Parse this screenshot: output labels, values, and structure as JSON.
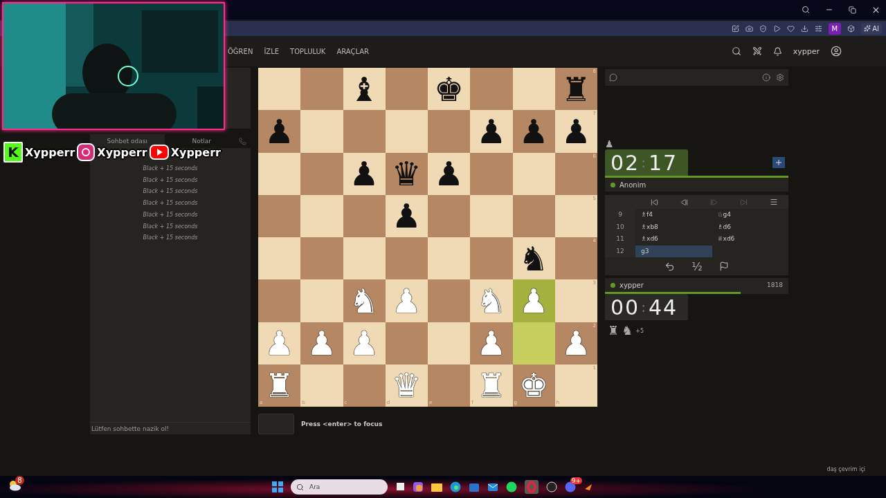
{
  "browser": {
    "profile_badge": "M",
    "ai_button": "AI"
  },
  "stream_overlay": {
    "handles": [
      {
        "kind": "kick",
        "badge": "K",
        "name": "Xypperr"
      },
      {
        "kind": "instagram",
        "name": "Xypperr"
      },
      {
        "kind": "youtube",
        "name": "Xypperr"
      }
    ]
  },
  "site_header": {
    "nav": [
      "ÖĞREN",
      "İZLE",
      "TOPLULUK",
      "ARAÇLAR"
    ],
    "username": "xypper"
  },
  "chat": {
    "tabs": [
      {
        "label": "Sohbet odası",
        "selected": true
      },
      {
        "label": "Notlar",
        "selected": false
      }
    ],
    "messages": [
      "Black + 15 seconds",
      "Black + 15 seconds",
      "Black + 15 seconds",
      "Black + 15 seconds",
      "Black + 15 seconds",
      "Black + 15 seconds",
      "Black + 15 seconds"
    ],
    "placeholder": "Lütfen sohbette nazik ol!"
  },
  "board": {
    "files": [
      "a",
      "b",
      "c",
      "d",
      "e",
      "f",
      "g",
      "h"
    ],
    "rows": [
      {
        "rank": "8",
        "squares": [
          {
            "highlighted": false
          },
          {
            "highlighted": false
          },
          {
            "highlighted": false,
            "piece": {
              "glyph": "♝",
              "white": false
            }
          },
          {
            "highlighted": false
          },
          {
            "highlighted": false,
            "piece": {
              "glyph": "♚",
              "white": false
            }
          },
          {
            "highlighted": false
          },
          {
            "highlighted": false
          },
          {
            "highlighted": false,
            "piece": {
              "glyph": "♜",
              "white": false
            }
          }
        ]
      },
      {
        "rank": "7",
        "squares": [
          {
            "highlighted": false,
            "piece": {
              "glyph": "♟",
              "white": false
            }
          },
          {
            "highlighted": false
          },
          {
            "highlighted": false
          },
          {
            "highlighted": false
          },
          {
            "highlighted": false
          },
          {
            "highlighted": false,
            "piece": {
              "glyph": "♟",
              "white": false
            }
          },
          {
            "highlighted": false,
            "piece": {
              "glyph": "♟",
              "white": false
            }
          },
          {
            "highlighted": false,
            "piece": {
              "glyph": "♟",
              "white": false
            }
          }
        ]
      },
      {
        "rank": "6",
        "squares": [
          {
            "highlighted": false
          },
          {
            "highlighted": false
          },
          {
            "highlighted": false,
            "piece": {
              "glyph": "♟",
              "white": false
            }
          },
          {
            "highlighted": false,
            "piece": {
              "glyph": "♛",
              "white": false
            }
          },
          {
            "highlighted": false,
            "piece": {
              "glyph": "♟",
              "white": false
            }
          },
          {
            "highlighted": false
          },
          {
            "highlighted": false
          },
          {
            "highlighted": false
          }
        ]
      },
      {
        "rank": "5",
        "squares": [
          {
            "highlighted": false
          },
          {
            "highlighted": false
          },
          {
            "highlighted": false
          },
          {
            "highlighted": false,
            "piece": {
              "glyph": "♟",
              "white": false
            }
          },
          {
            "highlighted": false
          },
          {
            "highlighted": false
          },
          {
            "highlighted": false
          },
          {
            "highlighted": false
          }
        ]
      },
      {
        "rank": "4",
        "squares": [
          {
            "highlighted": false
          },
          {
            "highlighted": false
          },
          {
            "highlighted": false
          },
          {
            "highlighted": false
          },
          {
            "highlighted": false
          },
          {
            "highlighted": false
          },
          {
            "highlighted": false,
            "piece": {
              "glyph": "♞",
              "white": false
            }
          },
          {
            "highlighted": false
          }
        ]
      },
      {
        "rank": "3",
        "squares": [
          {
            "highlighted": false
          },
          {
            "highlighted": false
          },
          {
            "highlighted": false,
            "piece": {
              "glyph": "♞",
              "white": true
            }
          },
          {
            "highlighted": false,
            "piece": {
              "glyph": "♟",
              "white": true
            }
          },
          {
            "highlighted": false
          },
          {
            "highlighted": false,
            "piece": {
              "glyph": "♞",
              "white": true
            }
          },
          {
            "highlighted": true,
            "piece": {
              "glyph": "♟",
              "white": true
            }
          },
          {
            "highlighted": false
          }
        ]
      },
      {
        "rank": "2",
        "squares": [
          {
            "highlighted": false,
            "piece": {
              "glyph": "♟",
              "white": true
            }
          },
          {
            "highlighted": false,
            "piece": {
              "glyph": "♟",
              "white": true
            }
          },
          {
            "highlighted": false,
            "piece": {
              "glyph": "♟",
              "white": true
            }
          },
          {
            "highlighted": false
          },
          {
            "highlighted": false
          },
          {
            "highlighted": false,
            "piece": {
              "glyph": "♟",
              "white": true
            }
          },
          {
            "highlighted": true
          },
          {
            "highlighted": false,
            "piece": {
              "glyph": "♟",
              "white": true
            }
          }
        ]
      },
      {
        "rank": "1",
        "squares": [
          {
            "highlighted": false,
            "piece": {
              "glyph": "♜",
              "white": true
            }
          },
          {
            "highlighted": false
          },
          {
            "highlighted": false
          },
          {
            "highlighted": false,
            "piece": {
              "glyph": "♛",
              "white": true
            }
          },
          {
            "highlighted": false
          },
          {
            "highlighted": false,
            "piece": {
              "glyph": "♜",
              "white": true
            }
          },
          {
            "highlighted": false,
            "piece": {
              "glyph": "♚",
              "white": true
            }
          },
          {
            "highlighted": false
          }
        ]
      }
    ]
  },
  "move_input": {
    "hint": "Press <enter> to focus"
  },
  "opponent": {
    "name": "Anonim",
    "online": true,
    "captured": [
      {
        "glyph": "♟"
      }
    ],
    "clock": {
      "minutes": "02",
      "separator": ":",
      "seconds": "17",
      "running": true
    },
    "level": 1
  },
  "moves": [
    {
      "number": "9",
      "moves": [
        {
          "san": "♗f4",
          "selected": false
        },
        {
          "san": "♘g4",
          "selected": false
        }
      ]
    },
    {
      "number": "10",
      "moves": [
        {
          "san": "♗xb8",
          "selected": false
        },
        {
          "san": "♗d6",
          "selected": false
        }
      ]
    },
    {
      "number": "11",
      "moves": [
        {
          "san": "♗xd6",
          "selected": false
        },
        {
          "san": "♕xd6",
          "selected": false
        }
      ]
    },
    {
      "number": "12",
      "moves": [
        {
          "san": "g3",
          "selected": true
        }
      ]
    }
  ],
  "actions": {
    "draw_offer": "½"
  },
  "player": {
    "name": "xypper",
    "online": true,
    "rating": "1818",
    "level": 0.74,
    "clock": {
      "minutes": "00",
      "separator": ":",
      "seconds": "44",
      "running": false
    },
    "material": [
      {
        "glyph": "♜"
      },
      {
        "glyph": "♞"
      }
    ],
    "advantage": "+5"
  },
  "taskbar": {
    "weather_badge": "8",
    "search_placeholder": "Ara",
    "discord_badge": "9+",
    "tray_text": "daş çevrim içi"
  }
}
